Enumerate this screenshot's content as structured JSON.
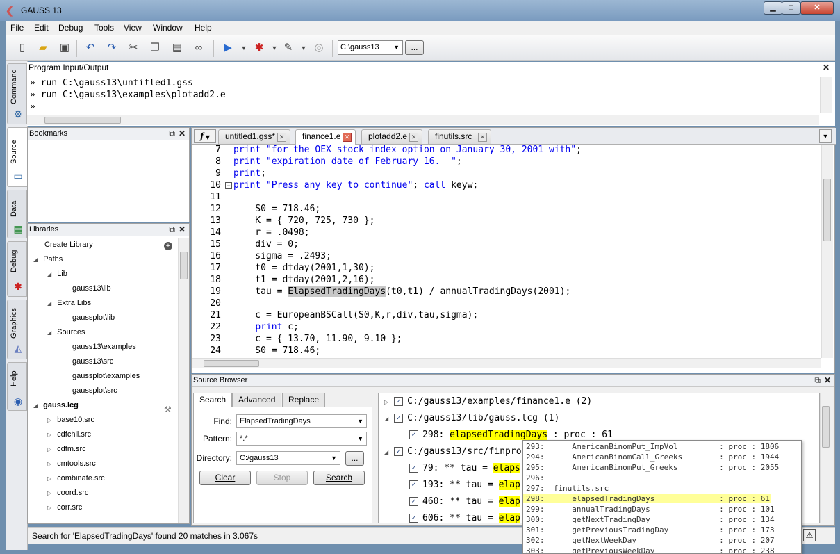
{
  "window": {
    "title": "GAUSS 13",
    "min": "▁",
    "max": "□",
    "close": "✕"
  },
  "menu": [
    "File",
    "Edit",
    "Debug",
    "Tools",
    "View",
    "Window",
    "Help"
  ],
  "toolbar": {
    "directory": "C:\\gauss13",
    "browse": "...",
    "icons": [
      "new-file-icon",
      "open-folder-icon",
      "save-icon",
      "undo-icon",
      "redo-icon",
      "cut-icon",
      "copy-icon",
      "paste-icon",
      "binoculars-icon",
      "run-icon",
      "debug-bug-icon",
      "edit-icon",
      "stop-icon"
    ]
  },
  "side_tabs": [
    "Command",
    "Source",
    "Data",
    "Debug",
    "Graphics",
    "Help"
  ],
  "io": {
    "title": "Program Input/Output",
    "lines": [
      "» run C:\\gauss13\\untitled1.gss",
      "» run C:\\gauss13\\examples\\plotadd2.e",
      "»"
    ]
  },
  "bookmarks": {
    "title": "Bookmarks"
  },
  "libraries": {
    "title": "Libraries",
    "items": [
      {
        "label": "Create Library",
        "indent": 0,
        "arrow": ""
      },
      {
        "label": "Paths",
        "indent": 0,
        "arrow": "◢"
      },
      {
        "label": "Lib",
        "indent": 1,
        "arrow": "◢"
      },
      {
        "label": "gauss13\\lib",
        "indent": 3,
        "arrow": ""
      },
      {
        "label": "Extra Libs",
        "indent": 1,
        "arrow": "◢"
      },
      {
        "label": "gaussplot\\lib",
        "indent": 3,
        "arrow": ""
      },
      {
        "label": "Sources",
        "indent": 1,
        "arrow": "◢"
      },
      {
        "label": "gauss13\\examples",
        "indent": 3,
        "arrow": ""
      },
      {
        "label": "gauss13\\src",
        "indent": 3,
        "arrow": ""
      },
      {
        "label": "gaussplot\\examples",
        "indent": 3,
        "arrow": ""
      },
      {
        "label": "gaussplot\\src",
        "indent": 3,
        "arrow": ""
      },
      {
        "label": "gauss.lcg",
        "indent": 0,
        "arrow": "◢"
      },
      {
        "label": "base10.src",
        "indent": 1,
        "arrow": "▷"
      },
      {
        "label": "cdfchii.src",
        "indent": 1,
        "arrow": "▷"
      },
      {
        "label": "cdfm.src",
        "indent": 1,
        "arrow": "▷"
      },
      {
        "label": "cmtools.src",
        "indent": 1,
        "arrow": "▷"
      },
      {
        "label": "combinate.src",
        "indent": 1,
        "arrow": "▷"
      },
      {
        "label": "coord.src",
        "indent": 1,
        "arrow": "▷"
      },
      {
        "label": "corr.src",
        "indent": 1,
        "arrow": "▷"
      }
    ]
  },
  "editor": {
    "func_button": "f",
    "tabs": [
      "untitled1.gss*",
      "finance1.e",
      "plotadd2.e",
      "finutils.src"
    ],
    "active_tab": 1,
    "lines": [
      {
        "n": "7",
        "text": "print \"for the OEX stock index option on January 30, 2001 with\";"
      },
      {
        "n": "8",
        "text": "print \"expiration date of February 16.  \";"
      },
      {
        "n": "9",
        "text": "print;"
      },
      {
        "n": "10",
        "text": "print \"Press any key to continue\"; call keyw;"
      },
      {
        "n": "11",
        "text": ""
      },
      {
        "n": "12",
        "text": "    S0 = 718.46;"
      },
      {
        "n": "13",
        "text": "    K = { 720, 725, 730 };"
      },
      {
        "n": "14",
        "text": "    r = .0498;"
      },
      {
        "n": "15",
        "text": "    div = 0;"
      },
      {
        "n": "16",
        "text": "    sigma = .2493;"
      },
      {
        "n": "17",
        "text": "    t0 = dtday(2001,1,30);"
      },
      {
        "n": "18",
        "text": "    t1 = dtday(2001,2,16);"
      },
      {
        "n": "19",
        "text": "    tau = ElapsedTradingDays(t0,t1) / annualTradingDays(2001);"
      },
      {
        "n": "20",
        "text": ""
      },
      {
        "n": "21",
        "text": "    c = EuropeanBSCall(S0,K,r,div,tau,sigma);"
      },
      {
        "n": "22",
        "text": "    print c;"
      },
      {
        "n": "23",
        "text": "    c = { 13.70, 11.90, 9.10 };"
      },
      {
        "n": "24",
        "text": "    S0 = 718.46;"
      }
    ]
  },
  "source_browser": {
    "title": "Source Browser",
    "tabs": [
      "Search",
      "Advanced",
      "Replace"
    ],
    "find_label": "Find:",
    "find_value": "ElapsedTradingDays",
    "pattern_label": "Pattern:",
    "pattern_value": "*.*",
    "directory_label": "Directory:",
    "directory_value": "C:/gauss13",
    "browse": "...",
    "buttons": {
      "clear": "Clear",
      "stop": "Stop",
      "search": "Search"
    },
    "results": [
      {
        "arrow": "▷",
        "text": "C:/gauss13/examples/finance1.e (2)",
        "indent": 0
      },
      {
        "arrow": "◢",
        "text": "C:/gauss13/lib/gauss.lcg (1)",
        "indent": 0
      },
      {
        "arrow": "",
        "pre": "298: ",
        "hl": "elapsedTradingDays",
        "post": " : proc : 61",
        "indent": 1
      },
      {
        "arrow": "◢",
        "text": "C:/gauss13/src/finpro",
        "indent": 0
      },
      {
        "arrow": "",
        "pre": "79: ** tau = ",
        "hl": "elaps",
        "post": "",
        "indent": 1
      },
      {
        "arrow": "",
        "pre": "193: ** tau = ",
        "hl": "elap",
        "post": "",
        "indent": 1
      },
      {
        "arrow": "",
        "pre": "460: ** tau = ",
        "hl": "elap",
        "post": "",
        "indent": 1
      },
      {
        "arrow": "",
        "pre": "606: ** tau = ",
        "hl": "elap",
        "post": "",
        "indent": 1
      }
    ],
    "popup": [
      "293:      AmericanBinomPut_ImpVol         : proc : 1806",
      "294:      AmericanBinomCall_Greeks        : proc : 1944",
      "295:      AmericanBinomPut_Greeks         : proc : 2055",
      "296:",
      "297:  finutils.src",
      "298:      elapsedTradingDays              : proc : 61",
      "299:      annualTradingDays               : proc : 101",
      "300:      getNextTradingDay               : proc : 134",
      "301:      getPreviousTradingDay           : proc : 173",
      "302:      getNextWeekDay                  : proc : 207",
      "303:      getPreviousWeekDay              : proc : 238"
    ]
  },
  "status": {
    "text": "Search for 'ElapsedTradingDays' found 20 matches in 3.067s"
  }
}
